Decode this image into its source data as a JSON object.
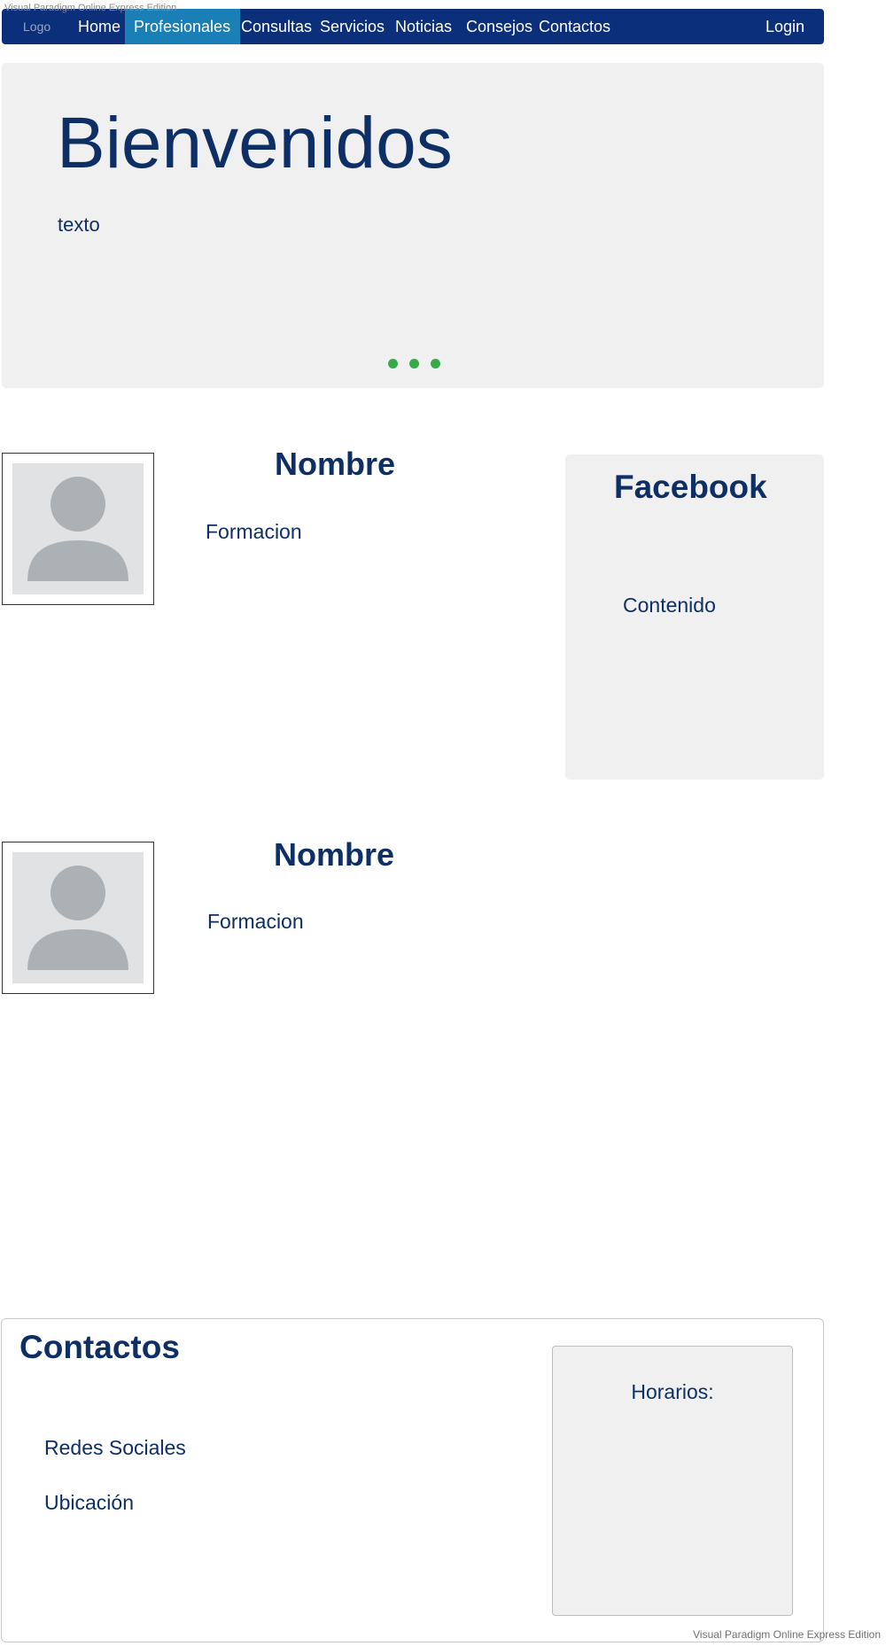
{
  "watermark": "Visual Paradigm Online Express Edition",
  "nav": {
    "logo": "Logo",
    "items": [
      {
        "label": "Home",
        "active": false
      },
      {
        "label": "Profesionales",
        "active": true
      },
      {
        "label": "Consultas",
        "active": false
      },
      {
        "label": "Servicios",
        "active": false
      },
      {
        "label": "Noticias",
        "active": false
      },
      {
        "label": "Consejos",
        "active": false
      },
      {
        "label": "Contactos",
        "active": false
      }
    ],
    "login": "Login"
  },
  "hero": {
    "title": "Bienvenidos",
    "text": "texto",
    "slide_count": 3
  },
  "professionals": [
    {
      "name": "Nombre",
      "training": "Formacion"
    },
    {
      "name": "Nombre",
      "training": "Formacion"
    }
  ],
  "facebook": {
    "title": "Facebook",
    "content": "Contenido"
  },
  "contact": {
    "title": "Contactos",
    "social": "Redes Sociales",
    "location": "Ubicación",
    "hours_label": "Horarios:"
  },
  "colors": {
    "nav_bg": "#0b2f7b",
    "nav_active": "#1a7fb6",
    "text_primary": "#0e2f66",
    "panel_bg": "#f0f0f0",
    "dot": "#3aaa48"
  }
}
